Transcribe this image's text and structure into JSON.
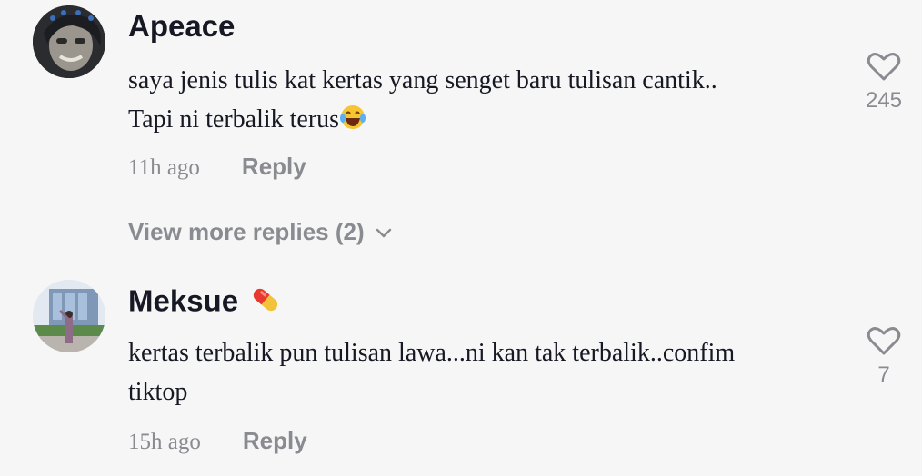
{
  "comments": [
    {
      "username": "Apeace",
      "text_line1": "saya jenis tulis kat kertas yang senget baru tulisan cantik..",
      "text_line2": "Tapi ni terbalik terus",
      "emoji": "laughing-crying-emoji",
      "time": "11h ago",
      "reply_label": "Reply",
      "likes": "245"
    },
    {
      "username": "Meksue",
      "username_emoji": "pill-emoji",
      "text_line1": "kertas terbalik pun tulisan lawa...ni kan tak terbalik..confim",
      "text_line2": "tiktop",
      "time": "15h ago",
      "reply_label": "Reply",
      "likes": "7"
    }
  ],
  "view_more_label": "View more replies (2)",
  "colors": {
    "background": "#f6f6f6",
    "text": "#161823",
    "muted": "#8a8b91"
  }
}
